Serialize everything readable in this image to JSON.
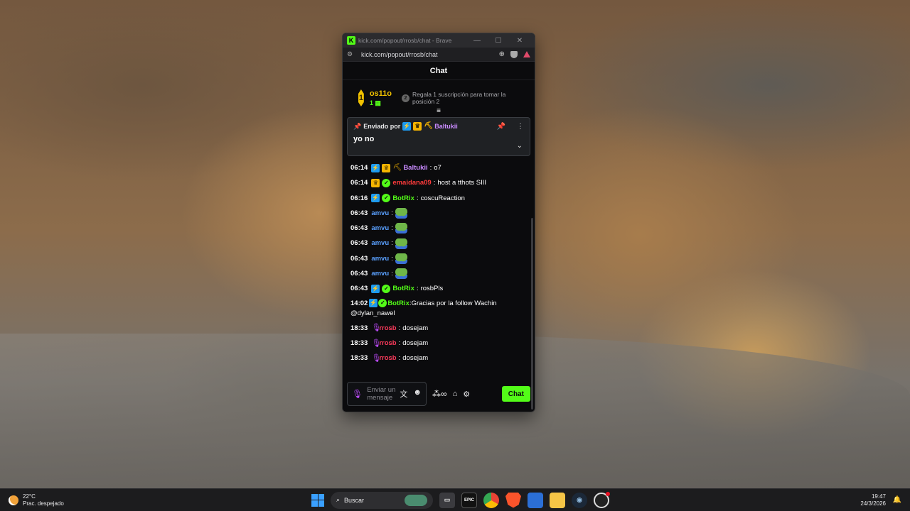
{
  "window": {
    "title": "kick.com/popout/rrosb/chat - Brave",
    "url": "kick.com/popout/rrosb/chat",
    "favicon": "K"
  },
  "chat": {
    "header": "Chat",
    "leaderboard": {
      "rank": "1",
      "name": "os11o",
      "count": "1",
      "position_circle": "2",
      "hint": "Regala 1 suscripción para tomar la posición 2"
    },
    "pinned": {
      "prefix": "Enviado por",
      "user": "Baltukii",
      "message": "yo no"
    },
    "messages": [
      {
        "time": "06:14",
        "badges": [
          "bolt",
          "crown",
          "pick"
        ],
        "user": "Baltukii",
        "color": "#c98bff",
        "text": "o7"
      },
      {
        "time": "06:14",
        "badges": [
          "crown",
          "verified"
        ],
        "user": "emaidana09",
        "color": "#ff3b3b",
        "text": "host a tthots SIII"
      },
      {
        "time": "06:16",
        "badges": [
          "bolt",
          "verified"
        ],
        "user": "BotRix",
        "color": "#53fc18",
        "text": "coscuReaction"
      },
      {
        "time": "06:43",
        "badges": [],
        "user": "amvu",
        "color": "#5aa0ff",
        "text": "",
        "emote": true
      },
      {
        "time": "06:43",
        "badges": [],
        "user": "amvu",
        "color": "#5aa0ff",
        "text": "",
        "emote": true
      },
      {
        "time": "06:43",
        "badges": [],
        "user": "amvu",
        "color": "#5aa0ff",
        "text": "",
        "emote": true
      },
      {
        "time": "06:43",
        "badges": [],
        "user": "amvu",
        "color": "#5aa0ff",
        "text": "",
        "emote": true
      },
      {
        "time": "06:43",
        "badges": [],
        "user": "amvu",
        "color": "#5aa0ff",
        "text": "",
        "emote": true
      },
      {
        "time": "06:43",
        "badges": [
          "bolt",
          "verified"
        ],
        "user": "BotRix",
        "color": "#53fc18",
        "text": "rosbPls"
      },
      {
        "time": "14:02",
        "badges": [
          "bolt",
          "verified"
        ],
        "user": "BotRix",
        "color": "#53fc18",
        "text": "Gracias por la follow Wachin @dylan_nawel",
        "wrap": true
      },
      {
        "time": "18:33",
        "badges": [
          "mic"
        ],
        "user": "rrosb",
        "color": "#ff3b5c",
        "text": "dosejam"
      },
      {
        "time": "18:33",
        "badges": [
          "mic"
        ],
        "user": "rrosb",
        "color": "#ff3b5c",
        "text": "dosejam"
      },
      {
        "time": "18:33",
        "badges": [
          "mic"
        ],
        "user": "rrosb",
        "color": "#ff3b5c",
        "text": "dosejam"
      }
    ],
    "composer": {
      "placeholder": "Enviar un mensaje",
      "send_label": "Chat"
    }
  },
  "taskbar": {
    "temperature": "22°C",
    "weather": "Prac. despejado",
    "search_placeholder": "Buscar",
    "time": "19:47",
    "date": "24/3/2026",
    "epic_label": "EPIC"
  }
}
